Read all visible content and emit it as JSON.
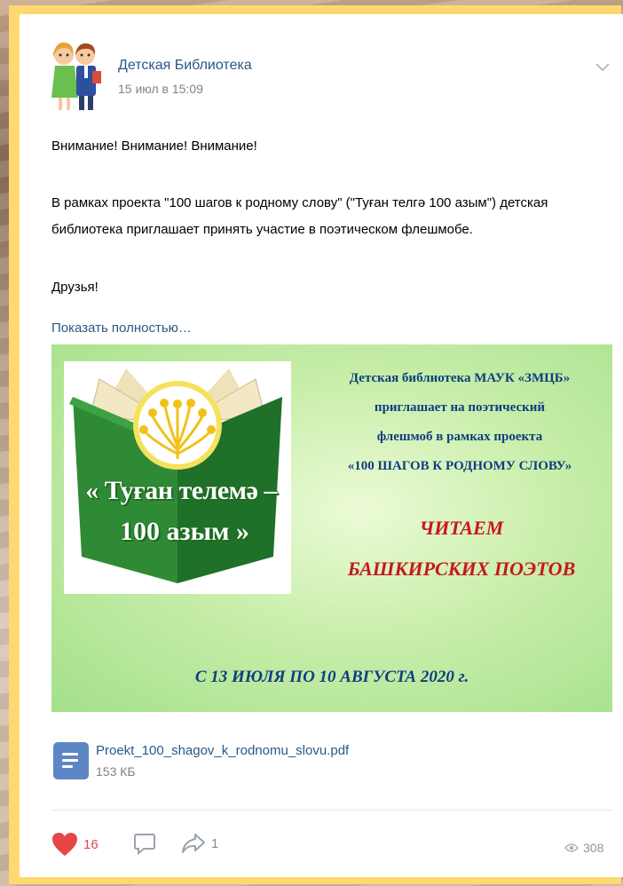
{
  "post": {
    "author": "Детская Библиотека",
    "date": "15 июл в 15:09",
    "text_line1": "Внимание! Внимание! Внимание!",
    "text_line2": "В рамках проекта \"100 шагов к родному слову\" (\"Туған телгә 100 азым\") детская",
    "text_line3": "библиотека приглашает принять участие в поэтическом флешмобе.",
    "text_line4": "Друзья!",
    "show_more": "Показать полностью…"
  },
  "banner": {
    "logo_line1": "« Туған телемә –",
    "logo_line2": "100 азым »",
    "org_line1": "Детская библиотека МАУК «ЗМЦБ»",
    "org_line2": "приглашает на поэтический",
    "org_line3": "флешмоб в рамках проекта",
    "org_line4": "«100 ШАГОВ К РОДНОМУ СЛОВУ»",
    "main_line1": "ЧИТАЕМ",
    "main_line2": "БАШКИРСКИХ ПОЭТОВ",
    "dates": "С 13 ИЮЛЯ ПО 10 АВГУСТА 2020 г."
  },
  "attachment": {
    "name": "Proekt_100_shagov_k_rodnomu_slovu.pdf",
    "size": "153 КБ",
    "icon": "document-icon"
  },
  "actions": {
    "likes": "16",
    "reposts": "1",
    "views": "308",
    "like_color": "#e64646"
  }
}
